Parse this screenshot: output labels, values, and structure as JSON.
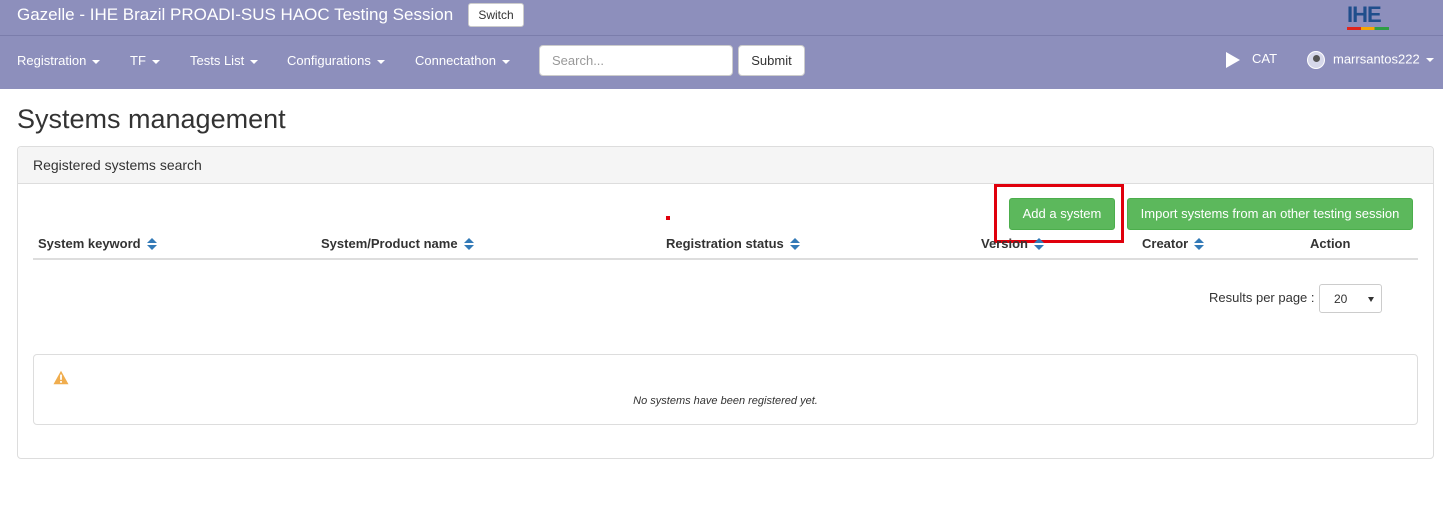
{
  "header": {
    "app_title": "Gazelle - IHE Brazil PROADI-SUS HAOC Testing Session",
    "switch_label": "Switch",
    "logo_text": "IHE"
  },
  "nav": {
    "menus": [
      {
        "label": "Registration"
      },
      {
        "label": "TF"
      },
      {
        "label": "Tests List"
      },
      {
        "label": "Configurations"
      },
      {
        "label": "Connectathon"
      }
    ],
    "search_placeholder": "Search...",
    "submit_label": "Submit",
    "cat_label": "CAT",
    "username": "marrsantos222"
  },
  "page": {
    "title": "Systems management"
  },
  "panel": {
    "title": "Registered systems search",
    "add_button": "Add a system",
    "import_button": "Import systems from an other testing session",
    "columns": [
      "System keyword",
      "System/Product name",
      "Registration status",
      "Version",
      "Creator",
      "Action"
    ],
    "results_per_page_label": "Results per page :",
    "results_per_page_value": "20",
    "empty_message": "No systems have been registered yet."
  },
  "colors": {
    "navbar": "#8d8fbc",
    "success": "#5cb85c",
    "highlight": "#e0000c",
    "sort_icon": "#337ab7",
    "warning": "#f0ad4e"
  }
}
